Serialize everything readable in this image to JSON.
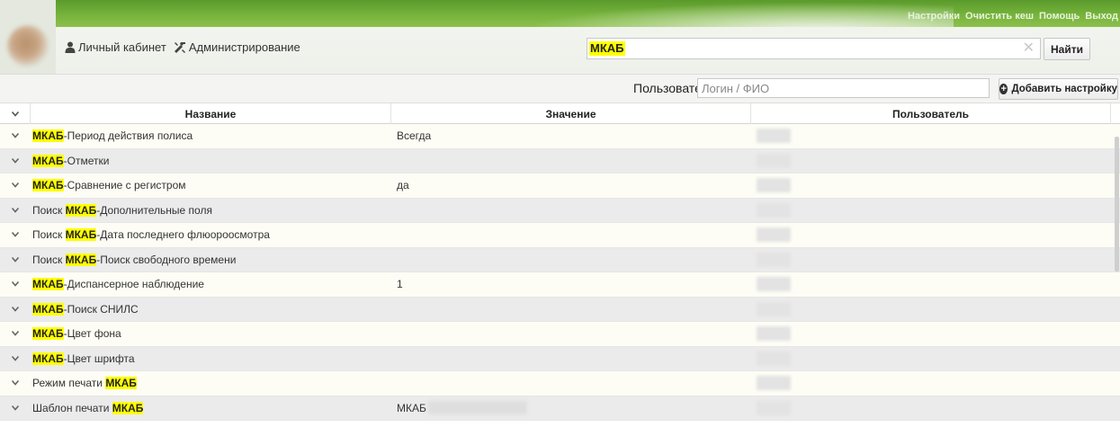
{
  "header": {
    "top_links": [
      "Настройки",
      "Очистить кеш",
      "Помощь",
      "Выход"
    ],
    "nav": [
      {
        "label": "Личный кабинет",
        "icon": "user-icon"
      },
      {
        "label": "Администрирование",
        "icon": "tools-icon"
      }
    ],
    "search": {
      "value": "МКАБ",
      "clear_icon": "close-icon"
    },
    "find_label": "Найти"
  },
  "filter": {
    "user_label": "Пользователь:",
    "user_placeholder": "Логин / ФИО",
    "add_label": "Добавить настройку"
  },
  "table": {
    "columns": [
      "Название",
      "Значение",
      "Пользователь"
    ],
    "rows": [
      {
        "pre": "",
        "hl": "МКАБ",
        "post": "-Период действия полиса",
        "value": "Всегда"
      },
      {
        "pre": "",
        "hl": "МКАБ",
        "post": "-Отметки",
        "value": ""
      },
      {
        "pre": "",
        "hl": "МКАБ",
        "post": "-Сравнение с регистром",
        "value": "да"
      },
      {
        "pre": "Поиск ",
        "hl": "МКАБ",
        "post": "-Дополнительные поля",
        "value": ""
      },
      {
        "pre": "Поиск ",
        "hl": "МКАБ",
        "post": "-Дата последнего флюорoосмотра",
        "value": ""
      },
      {
        "pre": "Поиск ",
        "hl": "МКАБ",
        "post": "-Поиск свободного времени",
        "value": ""
      },
      {
        "pre": "",
        "hl": "МКАБ",
        "post": "-Диспансерное наблюдение",
        "value": "1"
      },
      {
        "pre": "",
        "hl": "МКАБ",
        "post": "-Поиск СНИЛС",
        "value": ""
      },
      {
        "pre": "",
        "hl": "МКАБ",
        "post": "-Цвет фона",
        "value": ""
      },
      {
        "pre": "",
        "hl": "МКАБ",
        "post": "-Цвет шрифта",
        "value": ""
      },
      {
        "pre": "Режим печати ",
        "hl": "МКАБ",
        "post": "",
        "value": ""
      },
      {
        "pre": "Шаблон печати ",
        "hl": "МКАБ",
        "post": "",
        "value": "МКАБ"
      }
    ]
  },
  "colors": {
    "accent_green": "#74b13a",
    "highlight": "#ffff00"
  }
}
